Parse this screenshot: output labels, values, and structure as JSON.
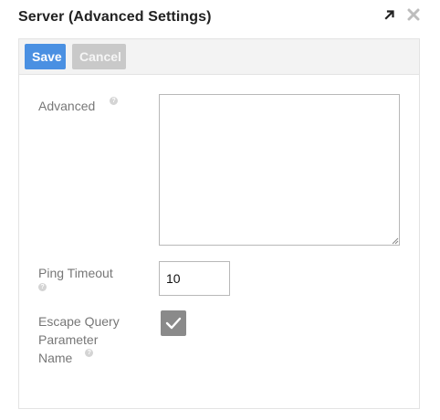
{
  "dialog": {
    "title": "Server (Advanced Settings)",
    "icons": [
      "expand-icon",
      "close-icon"
    ]
  },
  "toolbar": {
    "save_label": "Save",
    "cancel_label": "Cancel"
  },
  "form": {
    "advanced": {
      "label": "Advanced",
      "value": "",
      "help": "?"
    },
    "ping_timeout": {
      "label": "Ping Timeout",
      "value": "10",
      "help": "?"
    },
    "escape_query": {
      "label_line1": "Escape Query",
      "label_line2": "Parameter",
      "label_line3": "Name",
      "checked": true,
      "help": "?"
    }
  },
  "colors": {
    "save_button": "#4a90e2",
    "cancel_button": "#c9c9c9",
    "checkbox": "#8a8a8a"
  }
}
